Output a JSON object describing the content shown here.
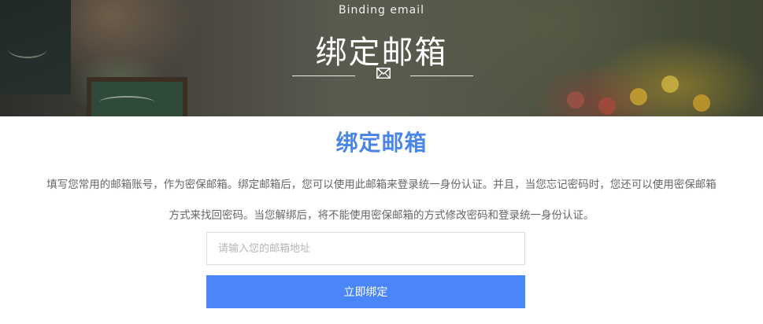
{
  "banner": {
    "subtitle": "Binding email",
    "title": "绑定邮箱",
    "icon": "envelope-icon"
  },
  "main": {
    "heading": "绑定邮箱",
    "description_line1": "填写您常用的邮箱账号，作为密保邮箱。绑定邮箱后，您可以使用此邮箱来登录统一身份认证。并且，当您忘记密码时，您还可以使用密保邮箱",
    "description_line2": "方式来找回密码。当您解绑后，将不能使用密保邮箱的方式修改密码和登录统一身份认证。"
  },
  "form": {
    "email_placeholder": "请输入您的邮箱地址",
    "email_value": "",
    "submit_label": "立即绑定"
  },
  "colors": {
    "accent": "#4a86e8",
    "button": "#4a86f7",
    "text": "#666666"
  }
}
